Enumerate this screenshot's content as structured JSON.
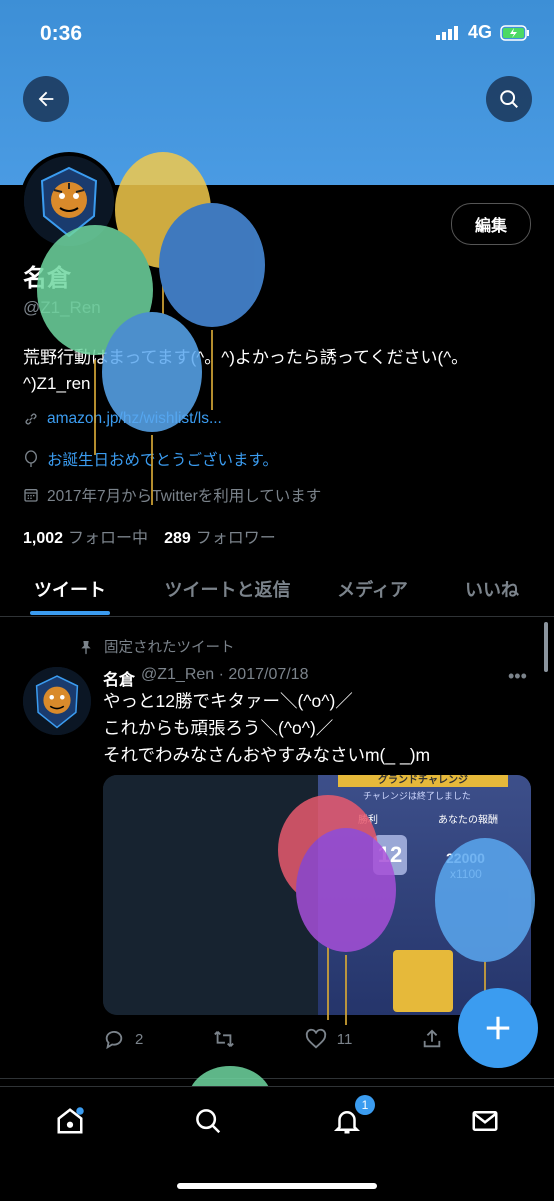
{
  "status_bar": {
    "time": "0:36",
    "network": "4G"
  },
  "profile": {
    "edit_label": "編集",
    "name": "名倉",
    "handle": "@Z1_Ren",
    "bio": "荒野行動はまってます(^。^)よかったら誘ってください(^。^)Z1_ren",
    "link": "amazon.jp/hz/wishlist/ls...",
    "birthday": "お誕生日おめでとうございます。",
    "joined": "2017年7月からTwitterを利用しています",
    "following_count": "1,002",
    "following_label": "フォロー中",
    "followers_count": "289",
    "followers_label": "フォロワー"
  },
  "tabs": [
    {
      "label": "ツイート"
    },
    {
      "label": "ツイートと返信"
    },
    {
      "label": "メディア"
    },
    {
      "label": "いいね"
    }
  ],
  "tweet": {
    "pinned_label": "固定されたツイート",
    "author": "名倉",
    "handle_date": "@Z1_Ren · 2017/07/18",
    "lines": [
      "やっと12勝でキタァー＼(^o^)／",
      "これからも頑張ろう＼(^o^)／",
      "それでわみなさんおやすみなさいm(_ _)m"
    ],
    "replies": "2",
    "likes": "11",
    "media_banner": "グランドチャレンジ",
    "media_sub": "チャレンジは終了しました",
    "media_wins_label": "勝利",
    "media_reward_label": "あなたの報酬",
    "media_wins": "12",
    "media_gold": "22000",
    "media_cards": "x1100"
  },
  "nav": {
    "notification_badge": "1"
  },
  "colors": {
    "accent": "#3b9cf0",
    "banner": "#4a9be3",
    "background": "#000000"
  },
  "icons": [
    "back-arrow-icon",
    "search-icon",
    "link-icon",
    "balloon-icon",
    "calendar-icon",
    "pin-icon",
    "reply-icon",
    "retweet-icon",
    "heart-icon",
    "share-icon",
    "plus-icon",
    "home-icon",
    "notification-bell-icon",
    "mail-icon"
  ]
}
